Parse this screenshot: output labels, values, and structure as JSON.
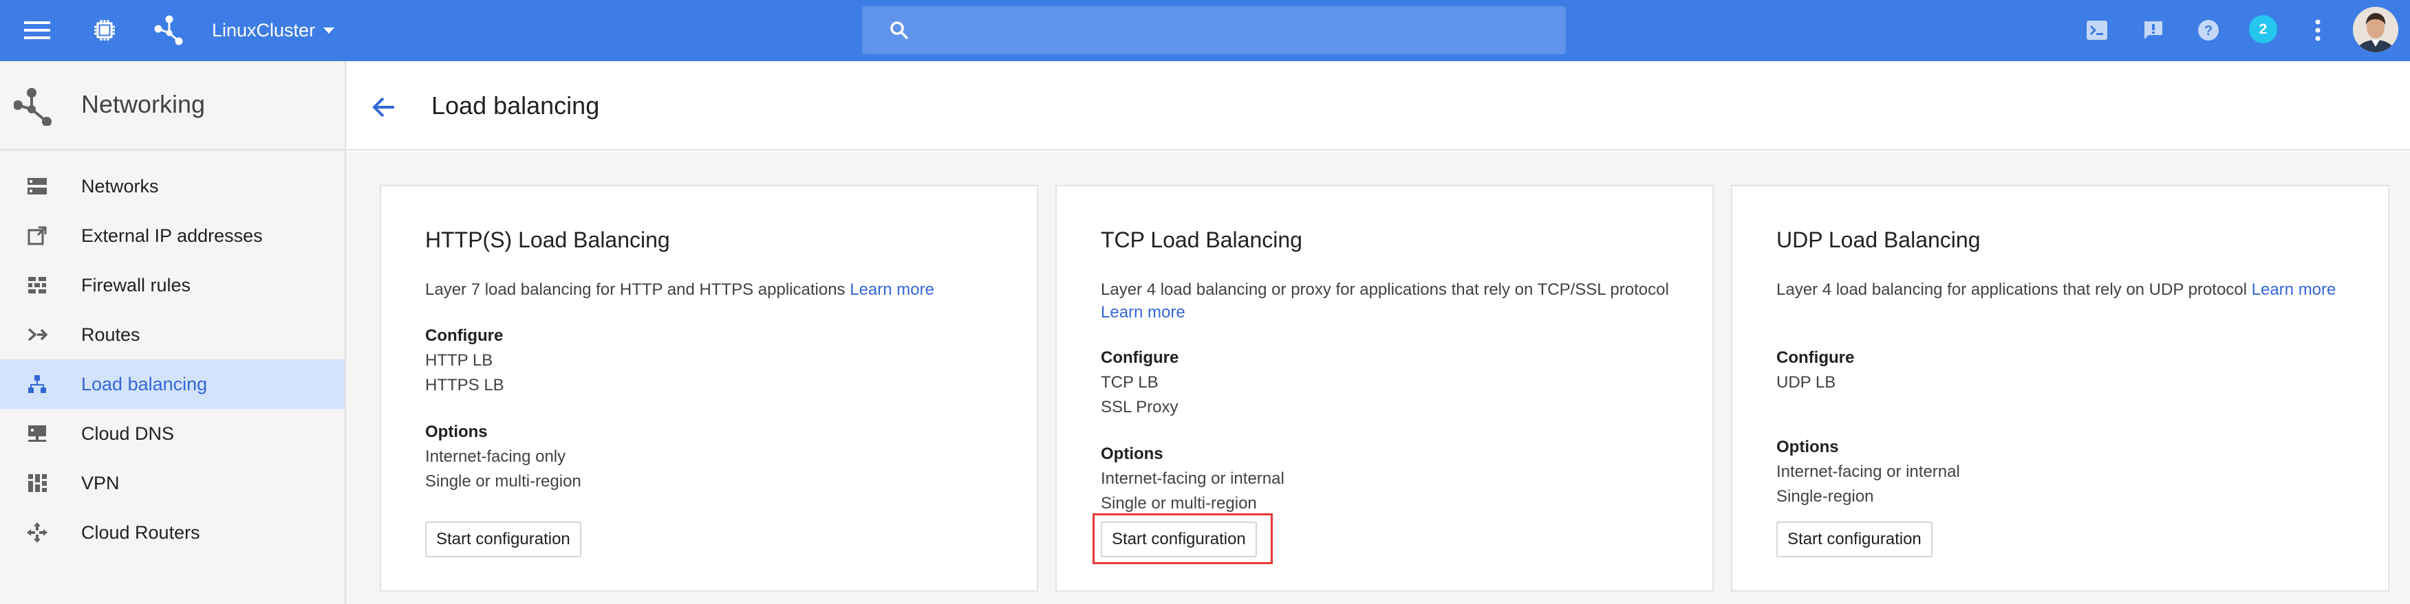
{
  "topbar": {
    "project_name": "LinuxCluster",
    "search_placeholder": "",
    "notification_count": "2"
  },
  "sidebar": {
    "title": "Networking",
    "items": [
      {
        "label": "Networks",
        "icon": "networks-icon"
      },
      {
        "label": "External IP addresses",
        "icon": "external-ip-icon"
      },
      {
        "label": "Firewall rules",
        "icon": "firewall-icon"
      },
      {
        "label": "Routes",
        "icon": "routes-icon"
      },
      {
        "label": "Load balancing",
        "icon": "load-balancing-icon",
        "active": true
      },
      {
        "label": "Cloud DNS",
        "icon": "cloud-dns-icon"
      },
      {
        "label": "VPN",
        "icon": "vpn-icon"
      },
      {
        "label": "Cloud Routers",
        "icon": "cloud-routers-icon"
      }
    ]
  },
  "main": {
    "page_title": "Load balancing",
    "cards": [
      {
        "title": "HTTP(S) Load Balancing",
        "description": "Layer 7 load balancing for HTTP and HTTPS applications",
        "learn_more": "Learn more",
        "configure_label": "Configure",
        "configure_items": [
          "HTTP LB",
          "HTTPS LB"
        ],
        "options_label": "Options",
        "options_items": [
          "Internet-facing only",
          "Single or multi-region"
        ],
        "button_label": "Start configuration"
      },
      {
        "title": "TCP Load Balancing",
        "description": "Layer 4 load balancing or proxy for applications that rely on TCP/SSL protocol",
        "learn_more": "Learn more",
        "configure_label": "Configure",
        "configure_items": [
          "TCP LB",
          "SSL Proxy"
        ],
        "options_label": "Options",
        "options_items": [
          "Internet-facing or internal",
          "Single or multi-region"
        ],
        "button_label": "Start configuration"
      },
      {
        "title": "UDP Load Balancing",
        "description": "Layer 4 load balancing for applications that rely on UDP protocol",
        "learn_more": "Learn more",
        "configure_label": "Configure",
        "configure_items": [
          "UDP LB"
        ],
        "options_label": "Options",
        "options_items": [
          "Internet-facing or internal",
          "Single-region"
        ],
        "button_label": "Start configuration"
      }
    ]
  },
  "colors": {
    "topbar": "#3d7de5",
    "accent": "#3367d6",
    "active_item_bg": "#d3e3fb",
    "badge": "#25c6f0",
    "highlight": "#e53935"
  }
}
